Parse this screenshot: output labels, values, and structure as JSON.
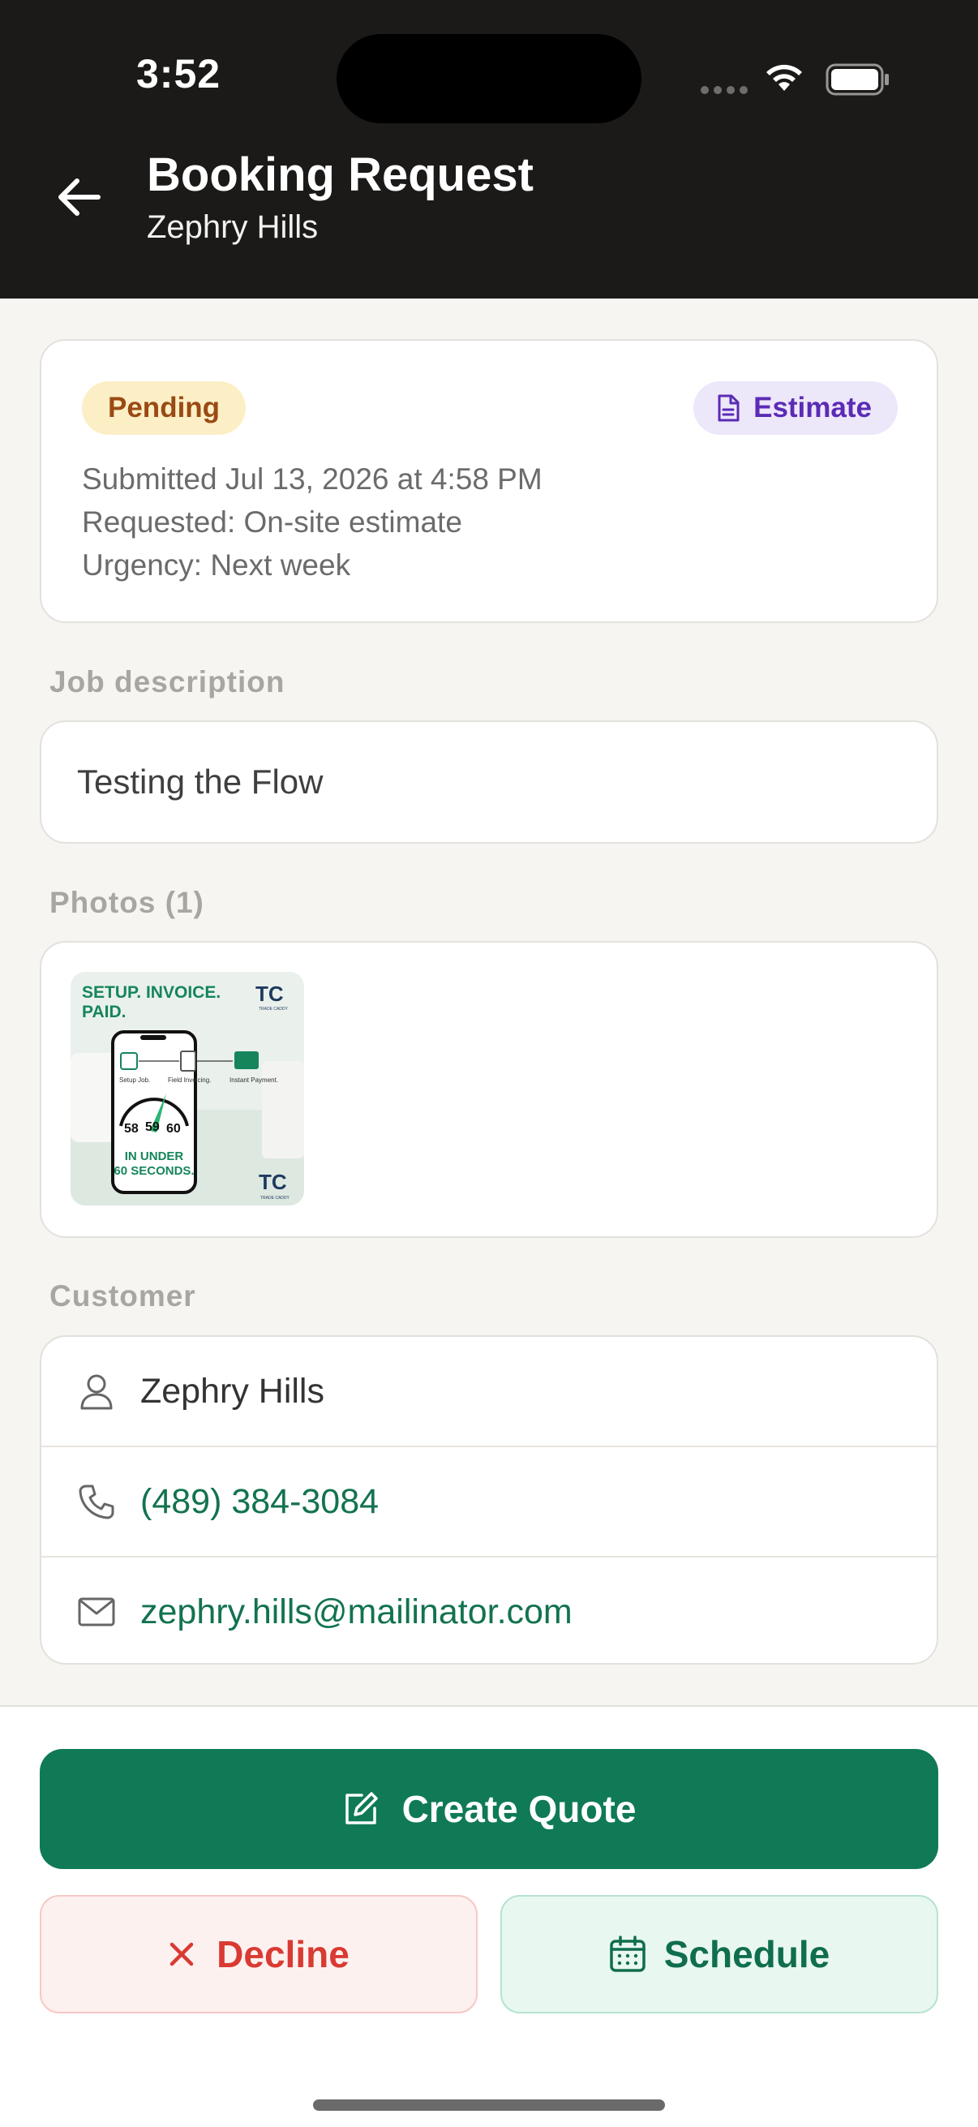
{
  "status_bar": {
    "time": "3:52"
  },
  "header": {
    "title": "Booking Request",
    "subtitle": "Zephry Hills"
  },
  "status_card": {
    "status_badge": "Pending",
    "type_badge": "Estimate",
    "submitted": "Submitted Jul 13, 2026 at 4:58 PM",
    "requested": "Requested: On-site estimate",
    "urgency": "Urgency: Next week"
  },
  "job_description": {
    "label": "Job description",
    "text": "Testing the Flow"
  },
  "photos": {
    "label": "Photos (1)",
    "thumbnail": {
      "headline_1": "SETUP. INVOICE.",
      "headline_2": "PAID.",
      "logo": "TC",
      "logo_sub": "TRADE CADDY",
      "step_1": "Setup Job.",
      "step_2": "Field Invoicing.",
      "step_3": "Instant Payment.",
      "timer_58": "58",
      "timer_59": "59",
      "timer_60": "60",
      "tagline_1": "IN UNDER",
      "tagline_2": "60 SECONDS."
    }
  },
  "customer": {
    "label": "Customer",
    "name": "Zephry Hills",
    "phone": "(489) 384-3084",
    "email": "zephry.hills@mailinator.com"
  },
  "actions": {
    "create_quote": "Create Quote",
    "decline": "Decline",
    "schedule": "Schedule"
  },
  "colors": {
    "header_bg": "#1B1A18",
    "primary_green": "#0F7A55",
    "link_green": "#13734F",
    "decline_red": "#D93A32",
    "pending_bg": "#FCEFC6",
    "estimate_purple": "#5B2BB5"
  },
  "icons": [
    "back-arrow-icon",
    "wifi-icon",
    "battery-icon",
    "document-icon",
    "person-icon",
    "phone-icon",
    "mail-icon",
    "edit-icon",
    "close-icon",
    "calendar-icon"
  ]
}
